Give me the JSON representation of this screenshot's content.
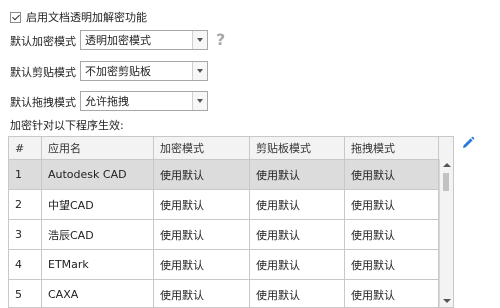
{
  "enable_checkbox": {
    "label": "启用文档透明加解密功能",
    "checked": true
  },
  "encrypt_mode": {
    "label": "默认加密模式",
    "value": "透明加密模式"
  },
  "clipboard_mode": {
    "label": "默认剪贴模式",
    "value": "不加密剪贴板"
  },
  "drag_mode": {
    "label": "默认拖拽模式",
    "value": "允许拖拽"
  },
  "help_icon": "question-mark-icon",
  "section_label": "加密针对以下程序生效:",
  "edit_icon": "pencil-icon",
  "table": {
    "headers": [
      "#",
      "应用名",
      "加密模式",
      "剪贴板模式",
      "拖拽模式"
    ],
    "rows": [
      [
        "1",
        "Autodesk CAD",
        "使用默认",
        "使用默认",
        "使用默认"
      ],
      [
        "2",
        "中望CAD",
        "使用默认",
        "使用默认",
        "使用默认"
      ],
      [
        "3",
        "浩辰CAD",
        "使用默认",
        "使用默认",
        "使用默认"
      ],
      [
        "4",
        "ETMark",
        "使用默认",
        "使用默认",
        "使用默认"
      ],
      [
        "5",
        "CAXA",
        "使用默认",
        "使用默认",
        "使用默认"
      ]
    ],
    "selected_row": 0
  },
  "colors": {
    "accent": "#2a7ad6",
    "selected_row": "#dcdcdc",
    "header_bg": "#f3f3f3"
  }
}
